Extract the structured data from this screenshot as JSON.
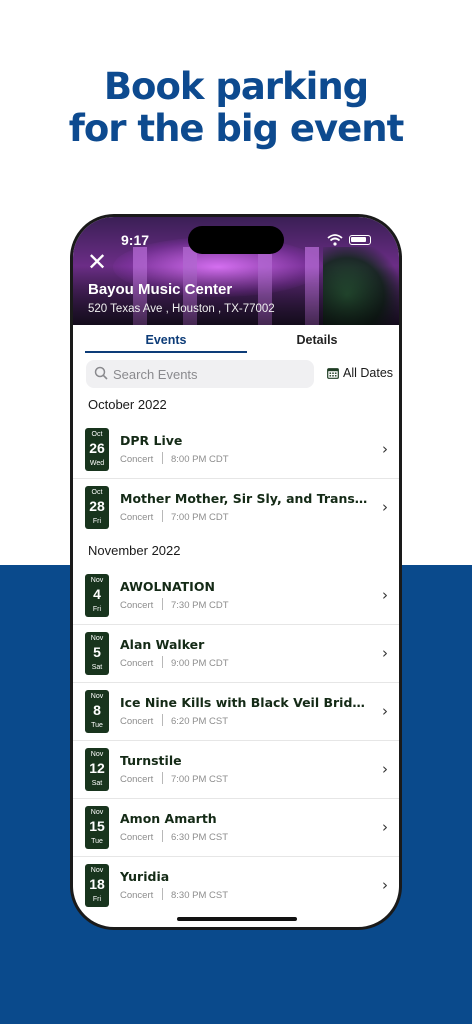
{
  "headline": {
    "line1": "Book parking",
    "line2": "for the big event"
  },
  "status_bar": {
    "time": "9:17"
  },
  "venue": {
    "name": "Bayou Music Center",
    "address": "520 Texas Ave , Houston , TX-77002"
  },
  "tabs": {
    "events": "Events",
    "details": "Details"
  },
  "search": {
    "placeholder": "Search Events",
    "dates_label": "All Dates"
  },
  "months": [
    "October 2022",
    "November 2022"
  ],
  "events": [
    {
      "month": "Oct",
      "day": "26",
      "weekday": "Wed",
      "title": "DPR Live",
      "type": "Concert",
      "time": "8:00 PM CDT"
    },
    {
      "month": "Oct",
      "day": "28",
      "weekday": "Fri",
      "title": "Mother Mother, Sir Sly, and Transviolet",
      "type": "Concert",
      "time": "7:00 PM CDT"
    },
    {
      "month": "Nov",
      "day": "4",
      "weekday": "Fri",
      "title": "AWOLNATION",
      "type": "Concert",
      "time": "7:30 PM CDT"
    },
    {
      "month": "Nov",
      "day": "5",
      "weekday": "Sat",
      "title": "Alan Walker",
      "type": "Concert",
      "time": "9:00 PM CDT"
    },
    {
      "month": "Nov",
      "day": "8",
      "weekday": "Tue",
      "title": "Ice Nine Kills with Black Veil Brides, M...",
      "type": "Concert",
      "time": "6:20 PM CST"
    },
    {
      "month": "Nov",
      "day": "12",
      "weekday": "Sat",
      "title": "Turnstile",
      "type": "Concert",
      "time": "7:00 PM CST"
    },
    {
      "month": "Nov",
      "day": "15",
      "weekday": "Tue",
      "title": "Amon Amarth",
      "type": "Concert",
      "time": "6:30 PM CST"
    },
    {
      "month": "Nov",
      "day": "18",
      "weekday": "Fri",
      "title": "Yuridia",
      "type": "Concert",
      "time": "8:30 PM CST"
    }
  ],
  "colors": {
    "brand_blue": "#0d4a8f",
    "band_blue": "#0a4a8c",
    "badge_green": "#18341d"
  }
}
